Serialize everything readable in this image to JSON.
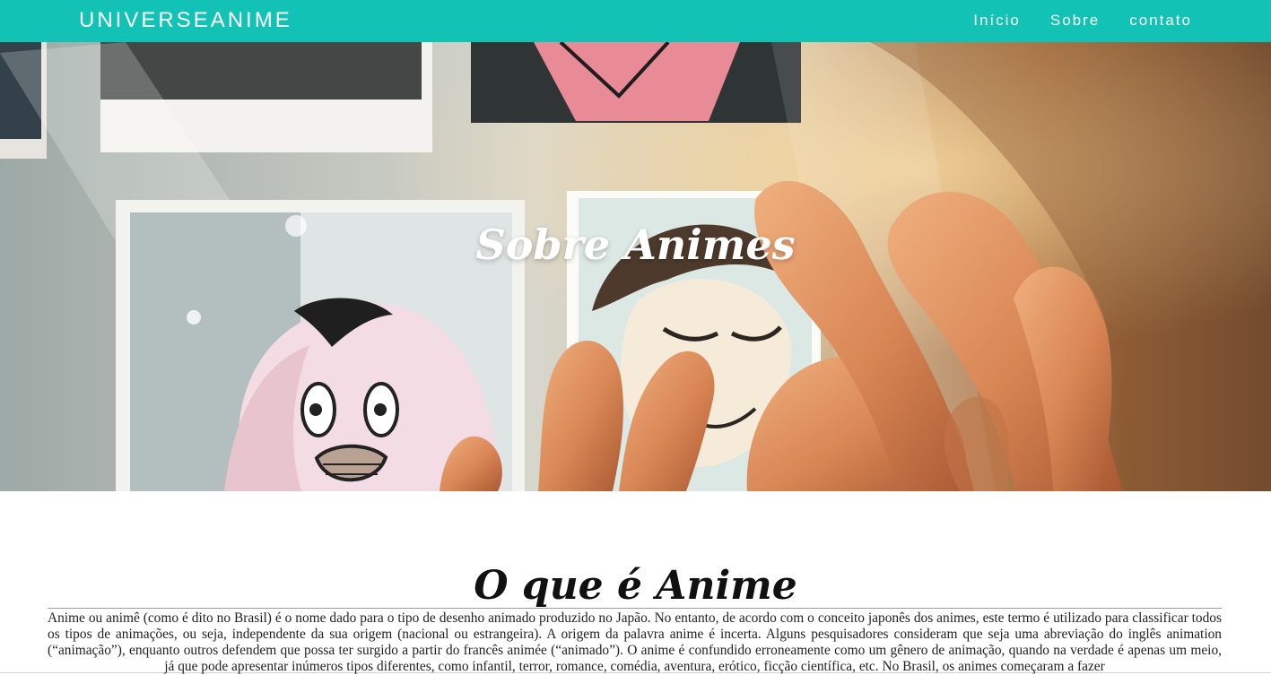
{
  "header": {
    "brand": "UNIVERSEANIME",
    "nav": [
      {
        "label": "Início"
      },
      {
        "label": "Sobre"
      },
      {
        "label": "contato"
      }
    ],
    "color": "#12c2b4"
  },
  "hero": {
    "title": "Sobre Animes"
  },
  "article": {
    "heading": "O que é Anime",
    "paragraph": "Anime ou animê (como é dito no Brasil) é o nome dado para o tipo de desenho animado produzido no Japão. No entanto, de acordo com o conceito japonês dos animes, este termo é utilizado para classificar todos os tipos de animações, ou seja, independente da sua origem (nacional ou estrangeira). A origem da palavra anime é incerta. Alguns pesquisadores consideram que seja uma abreviação do inglês animation (“animação”), enquanto outros defendem que possa ter surgido a partir do francês animée (“animado”). O anime é confundido erroneamente como um gênero de animação, quando na verdade é apenas um meio, já que pode apresentar inúmeros tipos diferentes, como infantil, terror, romance, comédia, aventura, erótico, ficção científica, etc. No Brasil, os animes começaram a fazer"
  }
}
